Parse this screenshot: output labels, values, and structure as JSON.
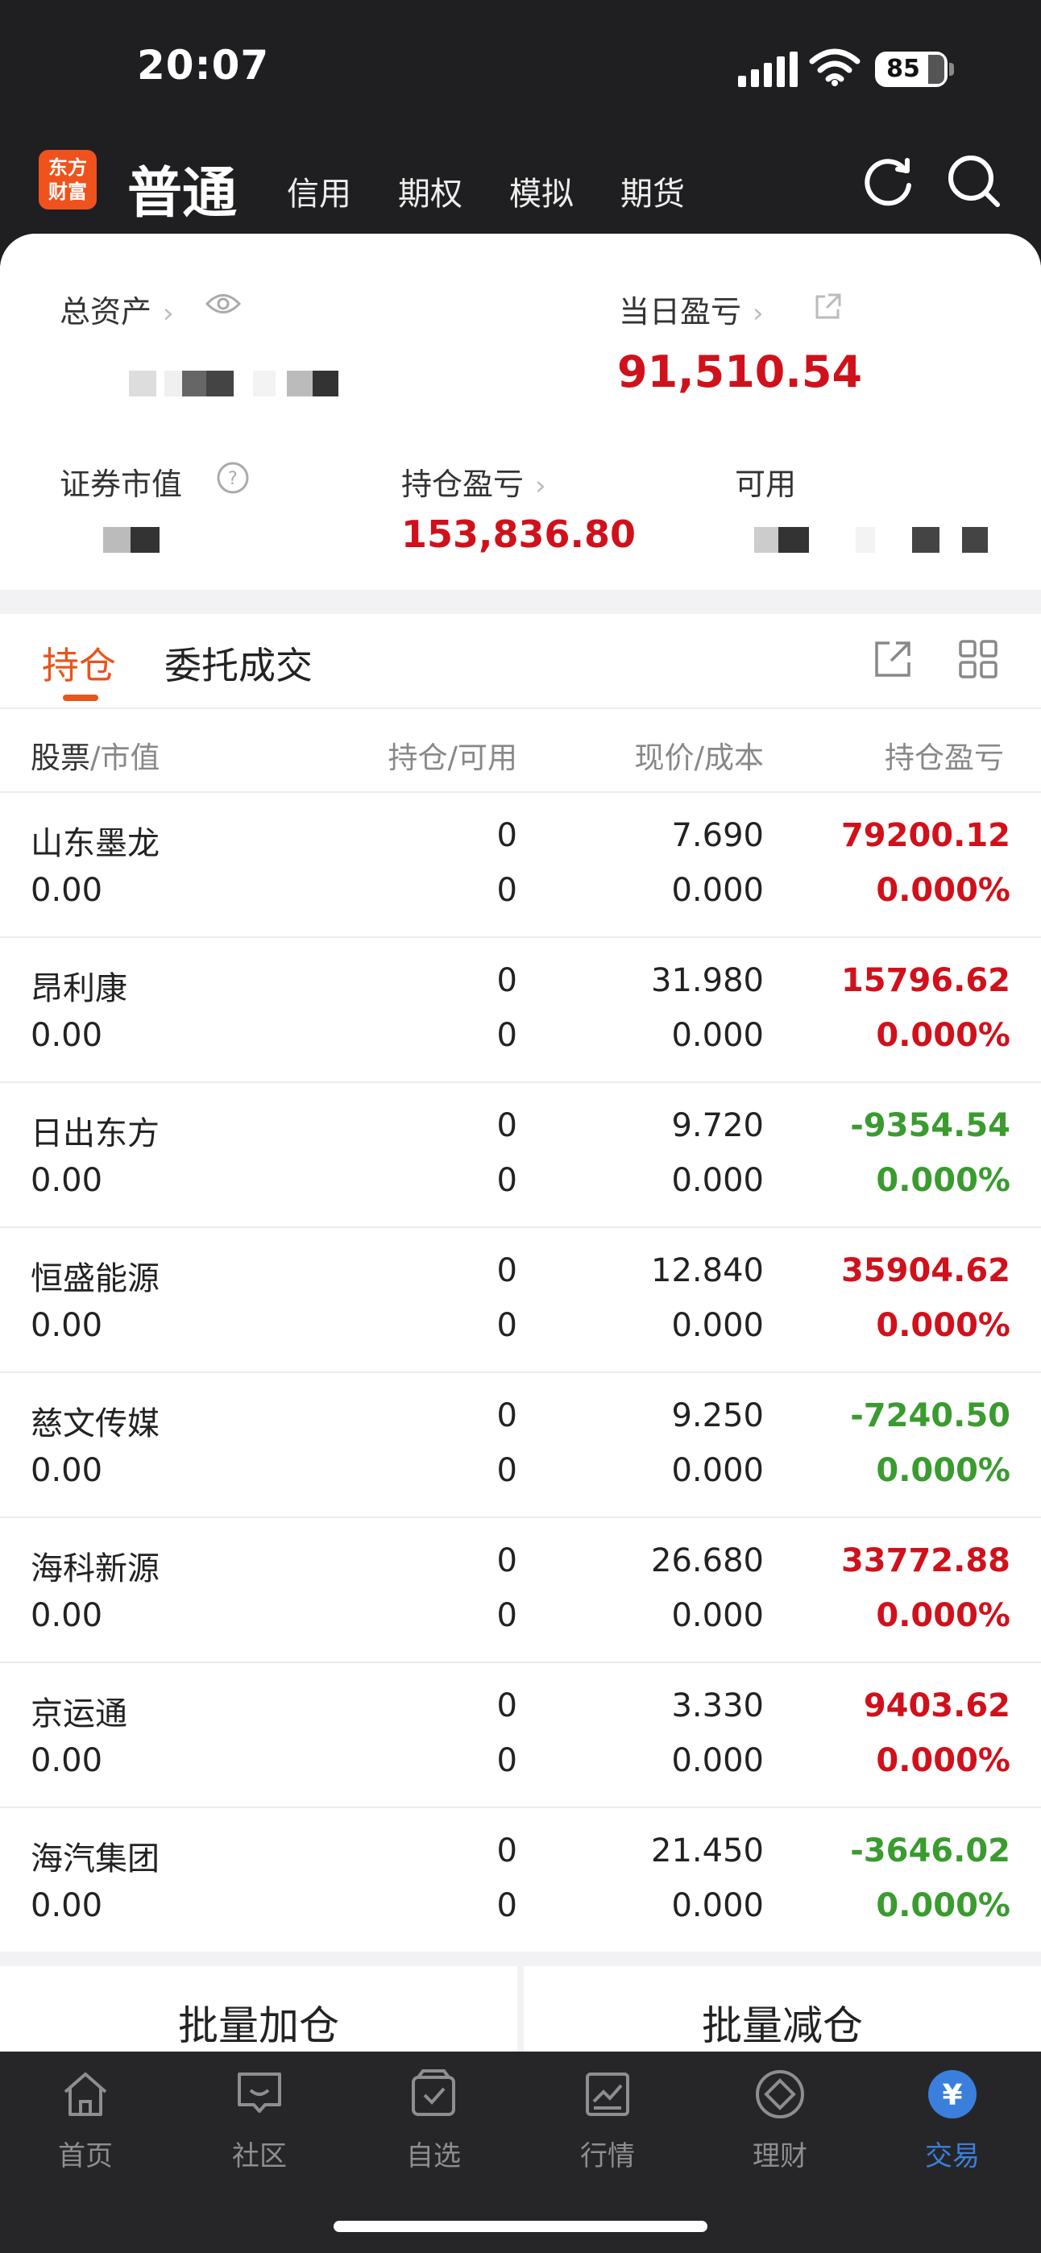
{
  "status": {
    "time": "20:07",
    "battery": "85"
  },
  "header": {
    "logo": "东方\n财富",
    "active_account": "普通",
    "tabs": [
      "信用",
      "期权",
      "模拟",
      "期货"
    ],
    "icons": [
      "refresh-icon",
      "search-icon"
    ]
  },
  "summary": {
    "total_assets_label": "总资产",
    "daily_pnl_label": "当日盈亏",
    "daily_pnl_value": "91,510.54",
    "market_value_label": "证券市值",
    "position_pnl_label": "持仓盈亏",
    "position_pnl_value": "153,836.80",
    "available_label": "可用"
  },
  "holdings_tabs": [
    "持仓",
    "委托成交"
  ],
  "table": {
    "headers": {
      "stock": "股票",
      "stock_sub": "/市值",
      "position": "持仓",
      "position_sub": "/可用",
      "price": "现价",
      "price_sub": "/成本",
      "pnl": "持仓盈亏"
    },
    "rows": [
      {
        "name": "山东墨龙",
        "market_value": "0.00",
        "position": "0",
        "available": "0",
        "price": "7.690",
        "cost": "0.000",
        "pnl": "79200.12",
        "pnl_pct": "0.000%",
        "trend": "up"
      },
      {
        "name": "昂利康",
        "market_value": "0.00",
        "position": "0",
        "available": "0",
        "price": "31.980",
        "cost": "0.000",
        "pnl": "15796.62",
        "pnl_pct": "0.000%",
        "trend": "up"
      },
      {
        "name": "日出东方",
        "market_value": "0.00",
        "position": "0",
        "available": "0",
        "price": "9.720",
        "cost": "0.000",
        "pnl": "-9354.54",
        "pnl_pct": "0.000%",
        "trend": "down"
      },
      {
        "name": "恒盛能源",
        "market_value": "0.00",
        "position": "0",
        "available": "0",
        "price": "12.840",
        "cost": "0.000",
        "pnl": "35904.62",
        "pnl_pct": "0.000%",
        "trend": "up"
      },
      {
        "name": "慈文传媒",
        "market_value": "0.00",
        "position": "0",
        "available": "0",
        "price": "9.250",
        "cost": "0.000",
        "pnl": "-7240.50",
        "pnl_pct": "0.000%",
        "trend": "down"
      },
      {
        "name": "海科新源",
        "market_value": "0.00",
        "position": "0",
        "available": "0",
        "price": "26.680",
        "cost": "0.000",
        "pnl": "33772.88",
        "pnl_pct": "0.000%",
        "trend": "up"
      },
      {
        "name": "京运通",
        "market_value": "0.00",
        "position": "0",
        "available": "0",
        "price": "3.330",
        "cost": "0.000",
        "pnl": "9403.62",
        "pnl_pct": "0.000%",
        "trend": "up"
      },
      {
        "name": "海汽集团",
        "market_value": "0.00",
        "position": "0",
        "available": "0",
        "price": "21.450",
        "cost": "0.000",
        "pnl": "-3646.02",
        "pnl_pct": "0.000%",
        "trend": "down"
      }
    ]
  },
  "batch": {
    "add": "批量加仓",
    "reduce": "批量减仓"
  },
  "nav": [
    {
      "label": "首页",
      "icon": "home-icon"
    },
    {
      "label": "社区",
      "icon": "community-icon"
    },
    {
      "label": "自选",
      "icon": "watchlist-icon"
    },
    {
      "label": "行情",
      "icon": "market-icon"
    },
    {
      "label": "理财",
      "icon": "wealth-icon"
    },
    {
      "label": "交易",
      "icon": "trade-icon",
      "active": true
    }
  ],
  "colors": {
    "up": "#d0111b",
    "down": "#3a9b2f",
    "accent": "#e8541a",
    "nav_active": "#3a7fdb"
  }
}
